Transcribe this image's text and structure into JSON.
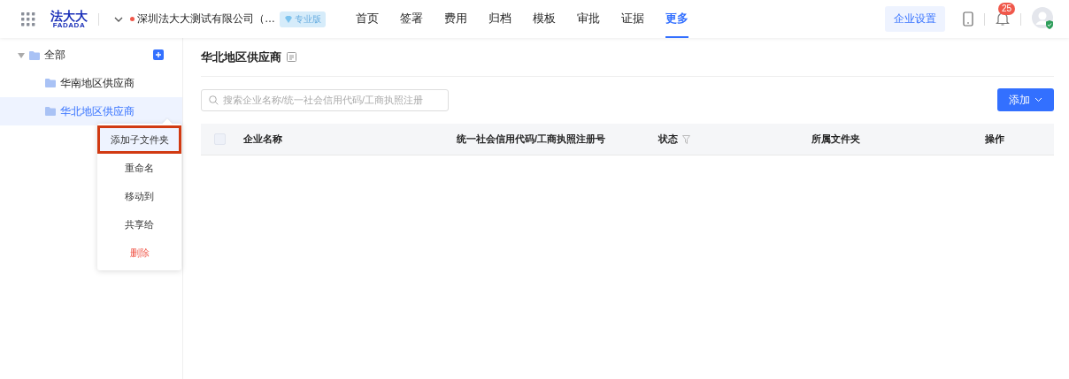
{
  "header": {
    "logo": {
      "top": "法大大",
      "bottom": "FADADA"
    },
    "company": "深圳法大大测试有限公司（…",
    "plan_badge": "专业版",
    "nav": [
      {
        "label": "首页",
        "selected": false
      },
      {
        "label": "签署",
        "selected": false
      },
      {
        "label": "费用",
        "selected": false
      },
      {
        "label": "归档",
        "selected": false
      },
      {
        "label": "模板",
        "selected": false
      },
      {
        "label": "审批",
        "selected": false
      },
      {
        "label": "证据",
        "selected": false
      },
      {
        "label": "更多",
        "selected": true
      }
    ],
    "settings_button": "企业设置",
    "notification_count": "25"
  },
  "sidebar": {
    "tree": [
      {
        "label": "全部",
        "expanded": true,
        "selected": false,
        "children": [
          {
            "label": "华南地区供应商",
            "selected": false
          },
          {
            "label": "华北地区供应商",
            "selected": true
          }
        ]
      }
    ]
  },
  "context_menu": {
    "items": [
      {
        "label": "添加子文件夹",
        "kind": "normal",
        "highlighted": true
      },
      {
        "label": "重命名",
        "kind": "normal",
        "highlighted": false
      },
      {
        "label": "移动到",
        "kind": "normal",
        "highlighted": false
      },
      {
        "label": "共享给",
        "kind": "normal",
        "highlighted": false
      },
      {
        "label": "删除",
        "kind": "danger",
        "highlighted": false
      }
    ]
  },
  "main": {
    "title": "华北地区供应商",
    "search": {
      "placeholder": "搜索企业名称/统一社会信用代码/工商执照注册"
    },
    "add_button": "添加",
    "table": {
      "select_all_checked": false,
      "columns": [
        {
          "label": "企业名称",
          "filter": false
        },
        {
          "label": "统一社会信用代码/工商执照注册号",
          "filter": false
        },
        {
          "label": "状态",
          "filter": true
        },
        {
          "label": "所属文件夹",
          "filter": false
        },
        {
          "label": "操作",
          "filter": false
        }
      ]
    }
  }
}
